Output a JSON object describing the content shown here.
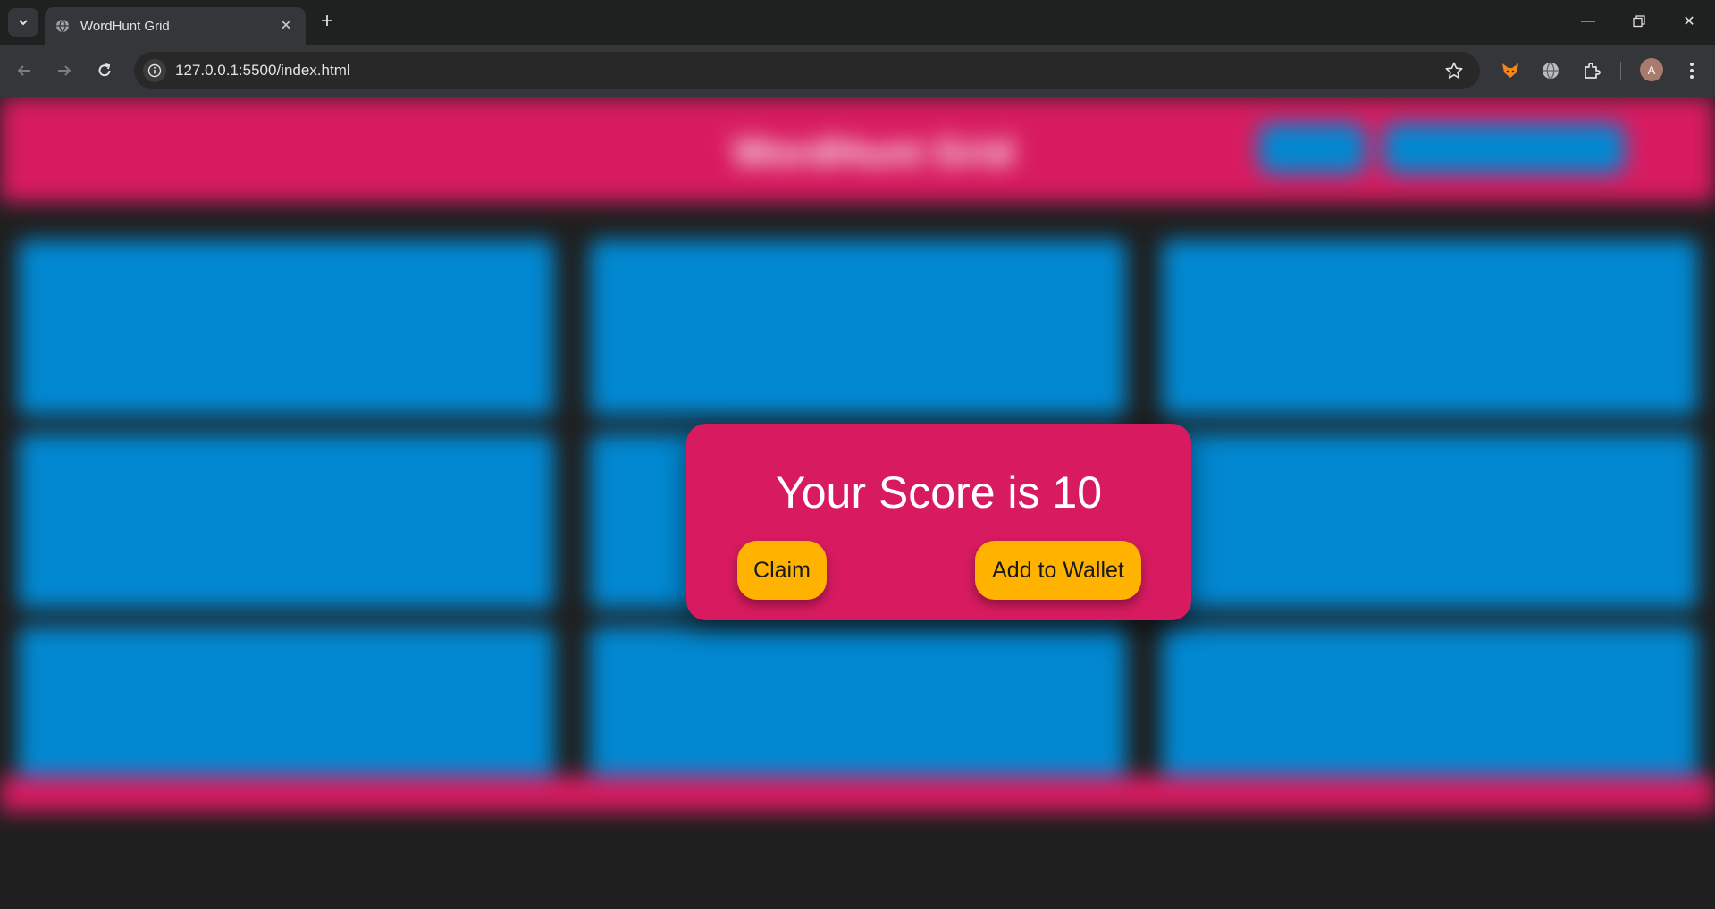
{
  "browser": {
    "tab_title": "WordHunt Grid",
    "url": "127.0.0.1:5500/index.html",
    "avatar_letter": "A"
  },
  "page": {
    "title": "WordHunt Grid",
    "header_buttons": [
      "",
      ""
    ],
    "categories": [
      "",
      "",
      "",
      "",
      "",
      "",
      "",
      "",
      ""
    ]
  },
  "modal": {
    "title": "Your Score is 10",
    "claim_label": "Claim",
    "wallet_label": "Add to Wallet"
  },
  "colors": {
    "accent_pink": "#d81b60",
    "tile_blue": "#0288d1",
    "button_amber": "#ffb300"
  },
  "icons": [
    "globe-icon",
    "close-icon",
    "plus-icon",
    "minimize-icon",
    "restore-icon",
    "back-arrow-icon",
    "forward-arrow-icon",
    "reload-icon",
    "info-icon",
    "star-icon",
    "fox-extension-icon",
    "globe-extension-icon",
    "puzzle-extension-icon",
    "kebab-menu-icon"
  ]
}
